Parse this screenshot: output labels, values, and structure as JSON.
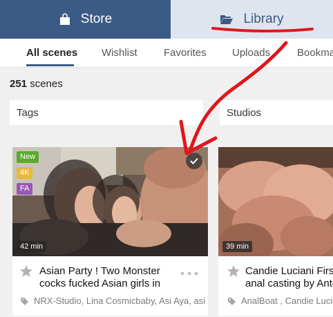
{
  "tabs": {
    "store": "Store",
    "library": "Library"
  },
  "subnav": {
    "items": [
      "All scenes",
      "Wishlist",
      "Favorites",
      "Uploads",
      "Bookma"
    ]
  },
  "count": {
    "number": "251",
    "label": "scenes"
  },
  "filters": {
    "tags": "Tags",
    "studios": "Studios"
  },
  "cards": [
    {
      "badges": [
        {
          "label": "New",
          "color": "#5aaa2e"
        },
        {
          "label": "4K",
          "color": "#e8b93a"
        },
        {
          "label": "FA",
          "color": "#9a58b6"
        }
      ],
      "duration": "42 min",
      "title_line1": "Asian Party ! Two Monster",
      "title_line2": "cocks fucked Asian girls in",
      "tags": "NRX-Studio, Lina Cosmicbaby, Asi Aya, asi"
    },
    {
      "duration": "39 min",
      "title_line1": "Candie Luciani First",
      "title_line2": "anal casting by Anto",
      "tags": "AnalBoat , Candie Lucia"
    }
  ],
  "colors": {
    "accent": "#3c5a86",
    "annotation": "#e0161b"
  }
}
